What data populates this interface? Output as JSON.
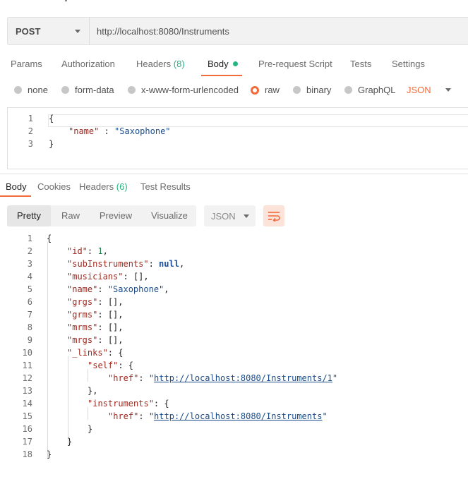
{
  "request": {
    "method": "POST",
    "url": "http://localhost:8080/Instruments"
  },
  "request_tabs": [
    {
      "label": "Params"
    },
    {
      "label": "Authorization"
    },
    {
      "label": "Headers",
      "count": "(8)"
    },
    {
      "label": "Body",
      "active": true
    },
    {
      "label": "Pre-request Script"
    },
    {
      "label": "Tests"
    },
    {
      "label": "Settings"
    }
  ],
  "body_types": [
    {
      "label": "none"
    },
    {
      "label": "form-data"
    },
    {
      "label": "x-www-form-urlencoded"
    },
    {
      "label": "raw",
      "checked": true
    },
    {
      "label": "binary"
    },
    {
      "label": "GraphQL"
    }
  ],
  "body_format": "JSON",
  "request_body": {
    "line_numbers": [
      "1",
      "2",
      "3"
    ],
    "open": "{",
    "key": "\"name\"",
    "sep": " : ",
    "value": "\"Saxophone\"",
    "close": "}"
  },
  "response_tabs": [
    {
      "label": "Body",
      "active": true
    },
    {
      "label": "Cookies"
    },
    {
      "label": "Headers",
      "count": "(6)"
    },
    {
      "label": "Test Results"
    }
  ],
  "response_views": [
    "Pretty",
    "Raw",
    "Preview",
    "Visualize"
  ],
  "response_format": "JSON",
  "response_body": {
    "line_numbers": [
      "1",
      "2",
      "3",
      "4",
      "5",
      "6",
      "7",
      "8",
      "9",
      "10",
      "11",
      "12",
      "13",
      "14",
      "15",
      "16",
      "17",
      "18"
    ],
    "id_key": "\"id\"",
    "id_val": "1",
    "sub_key": "\"subInstruments\"",
    "sub_val": "null",
    "mus_key": "\"musicians\"",
    "mus_val": "[]",
    "name_key": "\"name\"",
    "name_val": "\"Saxophone\"",
    "grgs_key": "\"grgs\"",
    "grgs_val": "[]",
    "grms_key": "\"grms\"",
    "grms_val": "[]",
    "mrms_key": "\"mrms\"",
    "mrms_val": "[]",
    "mrgs_key": "\"mrgs\"",
    "mrgs_val": "[]",
    "links_key": "\"_links\"",
    "self_key": "\"self\"",
    "href_key": "\"href\"",
    "self_href": "http://localhost:8080/Instruments/1",
    "inst_key": "\"instruments\"",
    "inst_href": "http://localhost:8080/Instruments"
  },
  "colors": {
    "accent": "#f26b3a",
    "count_green": "#26b47f",
    "json_key": "#a0281f",
    "json_string": "#1a4c8b"
  }
}
